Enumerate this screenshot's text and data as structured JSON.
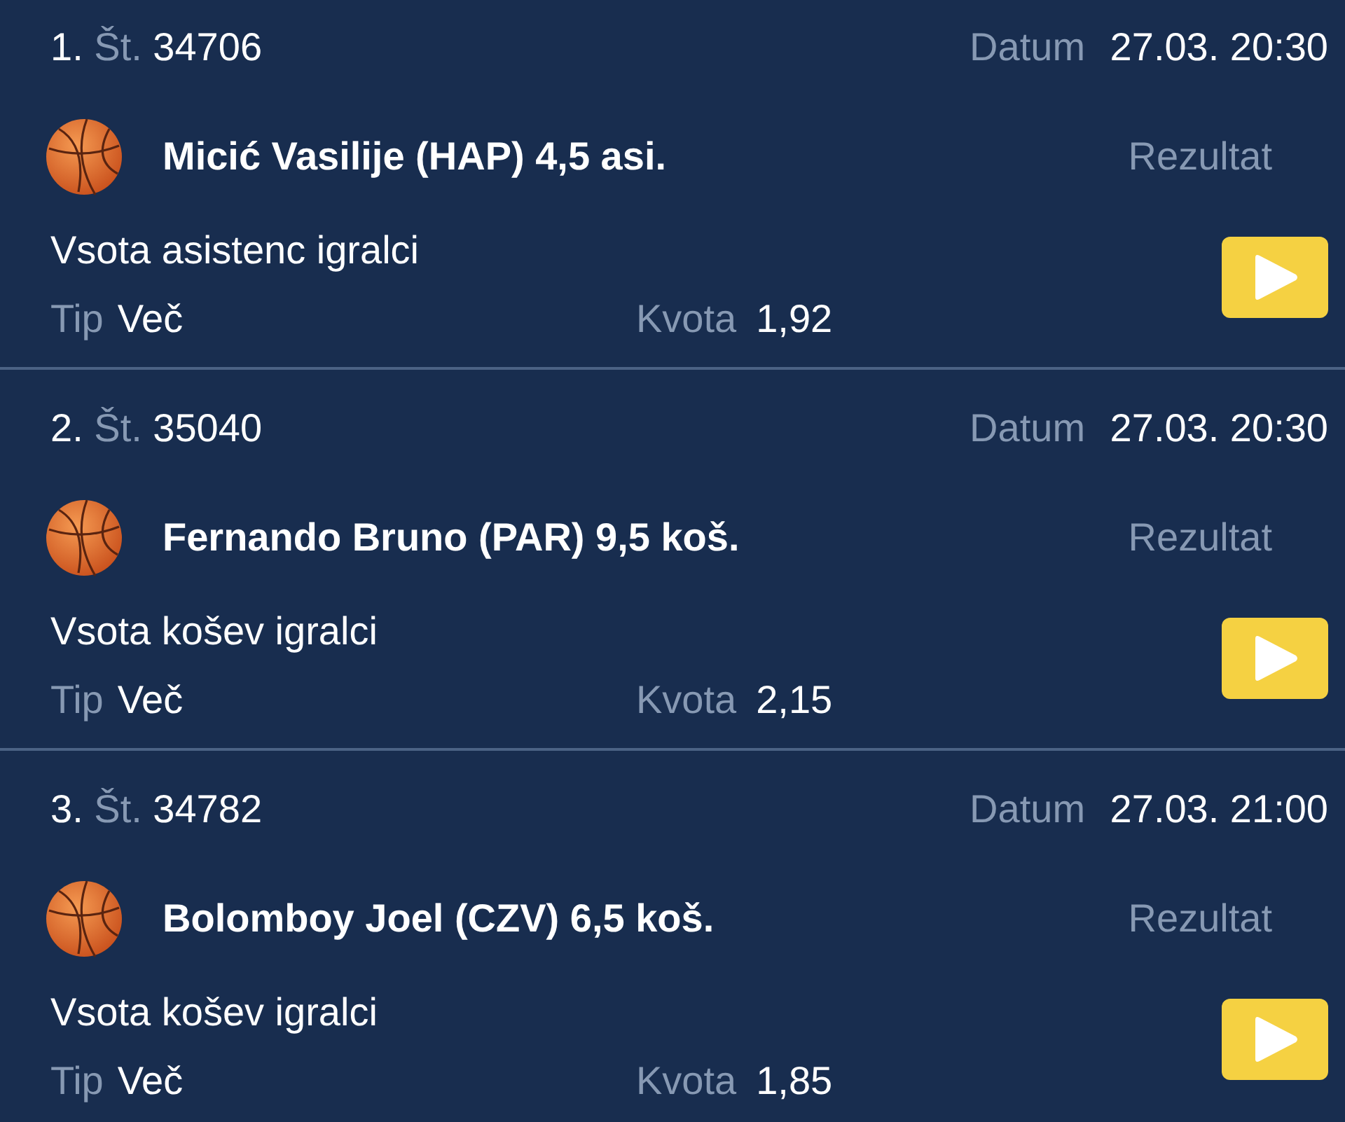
{
  "bets": [
    {
      "index": "1.",
      "number_label": "Št.",
      "number": "34706",
      "date_label": "Datum",
      "date": "27.03. 20:30",
      "event": "Micić Vasilije (HAP) 4,5 asi.",
      "result_label": "Rezultat",
      "market": "Vsota asistenc igralci",
      "tip_label": "Tip",
      "tip": "Več",
      "odds_label": "Kvota",
      "odds": "1,92"
    },
    {
      "index": "2.",
      "number_label": "Št.",
      "number": "35040",
      "date_label": "Datum",
      "date": "27.03. 20:30",
      "event": "Fernando Bruno (PAR) 9,5 koš.",
      "result_label": "Rezultat",
      "market": "Vsota košev igralci",
      "tip_label": "Tip",
      "tip": "Več",
      "odds_label": "Kvota",
      "odds": "2,15"
    },
    {
      "index": "3.",
      "number_label": "Št.",
      "number": "34782",
      "date_label": "Datum",
      "date": "27.03. 21:00",
      "event": "Bolomboy Joel (CZV) 6,5 koš.",
      "result_label": "Rezultat",
      "market": "Vsota košev igralci",
      "tip_label": "Tip",
      "tip": "Več",
      "odds_label": "Kvota",
      "odds": "1,85"
    }
  ]
}
